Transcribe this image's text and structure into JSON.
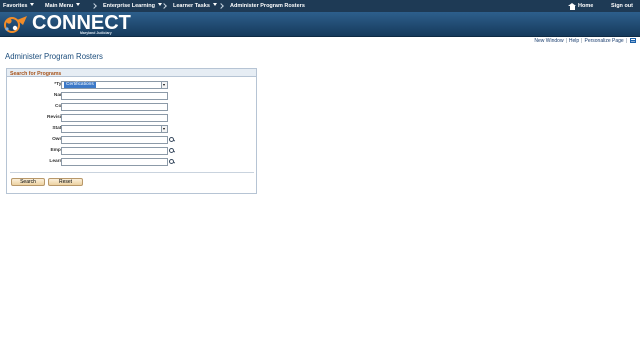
{
  "topnav": {
    "favorites": "Favorites",
    "main_menu": "Main Menu",
    "enterprise_learning": "Enterprise Learning",
    "learner_tasks": "Learner Tasks",
    "current_page": "Administer Program Rosters",
    "home": "Home",
    "sign_out": "Sign out"
  },
  "banner": {
    "logo_text": "CONNECT",
    "logo_sub": "Maryland Judiciary"
  },
  "utility_links": {
    "new_window": "New Window",
    "help": "Help",
    "personalize_page": "Personalize Page"
  },
  "page_title": "Administer Program Rosters",
  "search_panel": {
    "heading": "Search for Programs",
    "fields": {
      "type_label": "*Type",
      "type_value": "Certifications",
      "name_label": "Name",
      "code_label": "Code",
      "revision_label": "Revision",
      "status_label": "Status",
      "owner_label": "Owner",
      "emplid_label": "EmplID",
      "learner_label": "Learner"
    },
    "buttons": {
      "search": "Search",
      "reset": "Reset"
    }
  },
  "colors": {
    "nav_bg": "#1e3a55",
    "banner_bg": "#2d5f8c",
    "title_blue": "#1c4d7c",
    "panel_heading": "#a8541b"
  }
}
